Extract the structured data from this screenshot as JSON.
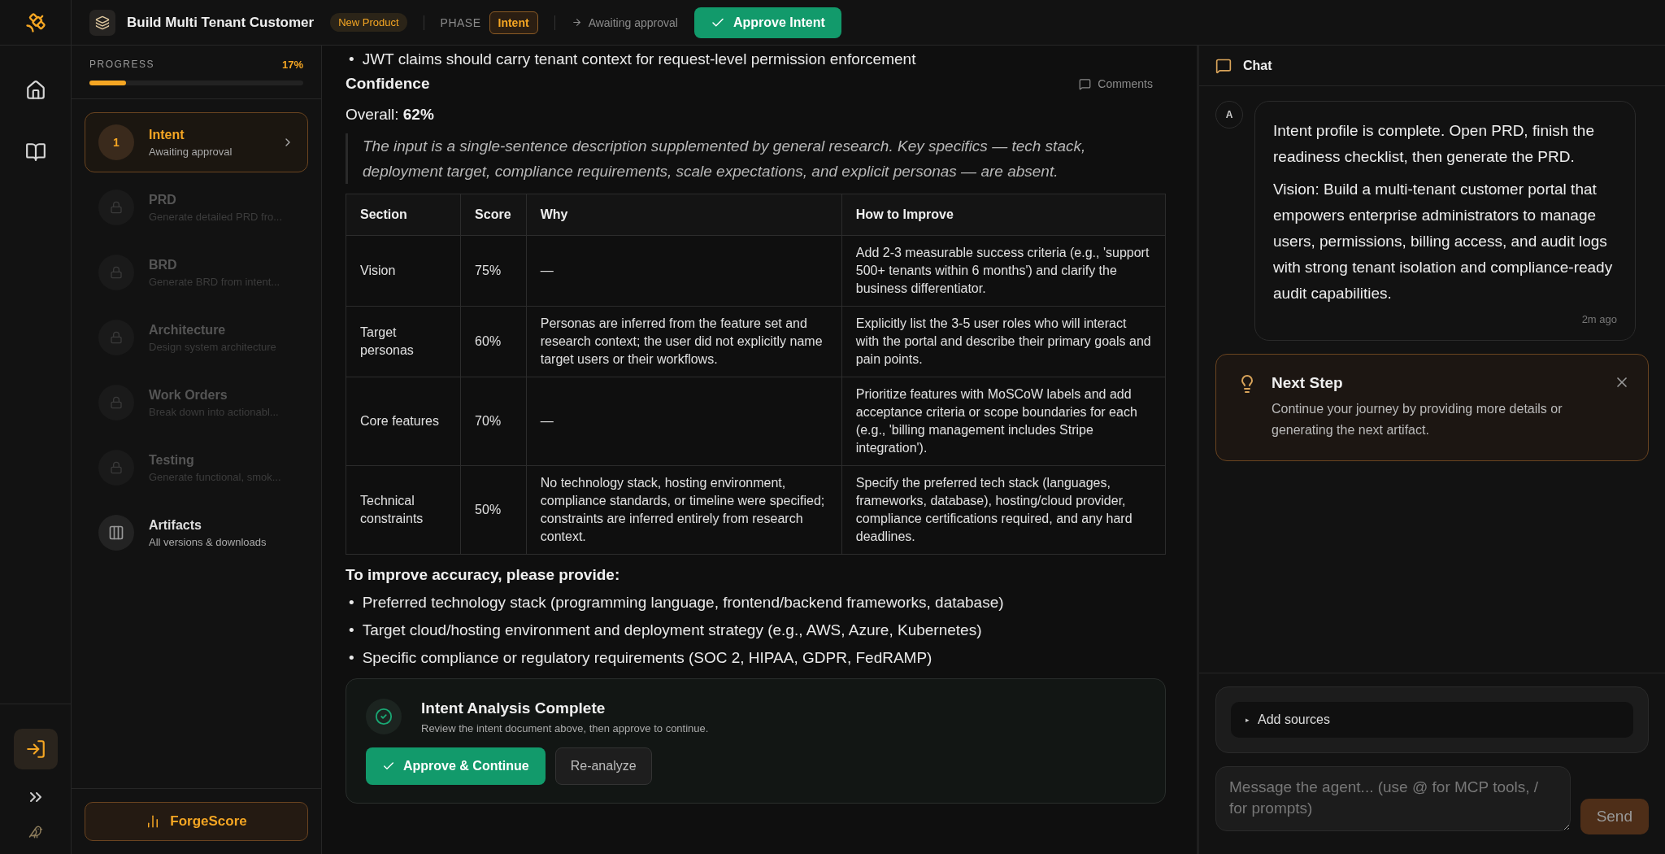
{
  "header": {
    "project_title": "Build Multi Tenant Customer",
    "badge": "New Product",
    "phase_label": "PHASE",
    "phase": "Intent",
    "status": "Awaiting approval",
    "approve_button": "Approve Intent"
  },
  "progress": {
    "label": "PROGRESS",
    "value": "17%",
    "level": 0.17
  },
  "steps": [
    {
      "kind": "numbered",
      "number": "1",
      "title": "Intent",
      "subtitle": "Awaiting approval",
      "selected": true
    },
    {
      "kind": "locked",
      "title": "PRD",
      "subtitle": "Generate detailed PRD fro...",
      "selected": false
    },
    {
      "kind": "locked",
      "title": "BRD",
      "subtitle": "Generate BRD from intent...",
      "selected": false
    },
    {
      "kind": "locked",
      "title": "Architecture",
      "subtitle": "Design system architecture",
      "selected": false
    },
    {
      "kind": "locked",
      "title": "Work Orders",
      "subtitle": "Break down into actionabl...",
      "selected": false
    },
    {
      "kind": "locked",
      "title": "Testing",
      "subtitle": "Generate functional, smok...",
      "selected": false
    },
    {
      "kind": "artifacts",
      "title": "Artifacts",
      "subtitle": "All versions & downloads",
      "selected": false
    }
  ],
  "forgescore_button": "ForgeScore",
  "document": {
    "bullet_marker": "•",
    "top_bullets": [
      "JWT claims should carry tenant context for request-level permission enforcement"
    ],
    "confidence_heading": "Confidence",
    "comments_button": "Comments",
    "overall": "Overall: **62%**",
    "quote": "The input is a single-sentence description supplemented by general research. Key specifics — tech stack, deployment target, compliance requirements, scale expectations, and explicit personas — are absent.",
    "table": {
      "columns": [
        "Section",
        "Score",
        "Why",
        "How to Improve"
      ],
      "rows": [
        [
          "Vision",
          "75%",
          "—",
          "Add 2-3 measurable success criteria (e.g., 'support 500+ tenants within 6 months') and clarify the business differentiator."
        ],
        [
          "Target personas",
          "60%",
          "Personas are inferred from the feature set and research context; the user did not explicitly name target users or their workflows.",
          "Explicitly list the 3-5 user roles who will interact with the portal and describe their primary goals and pain points."
        ],
        [
          "Core features",
          "70%",
          "—",
          "Prioritize features with MoSCoW labels and add acceptance criteria or scope boundaries for each (e.g., 'billing management includes Stripe integration')."
        ],
        [
          "Technical constraints",
          "50%",
          "No technology stack, hosting environment, compliance standards, or timeline were specified; constraints are inferred entirely from research context.",
          "Specify the preferred tech stack (languages, frameworks, database), hosting/cloud provider, compliance certifications required, and any hard deadlines."
        ]
      ]
    },
    "improve_heading": "To improve accuracy, please provide:",
    "improve_bullets": [
      "Preferred technology stack (programming language, frontend/backend frameworks, database)",
      "Target cloud/hosting environment and deployment strategy (e.g., AWS, Azure, Kubernetes)",
      "Specific compliance or regulatory requirements (SOC 2, HIPAA, GDPR, FedRAMP)"
    ]
  },
  "completion_card": {
    "title": "Intent Analysis Complete",
    "text": "Review the intent document above, then approve to continue.",
    "approve_button": "Approve & Continue",
    "reanalyze_button": "Re-analyze"
  },
  "chat": {
    "title": "Chat",
    "messages": [
      {
        "avatar": "A",
        "paragraphs": [
          "Intent profile is complete. Open PRD, finish the readiness checklist, then generate the PRD.",
          "Vision: Build a multi-tenant customer portal that empowers enterprise administrators to manage users, permissions, billing access, and audit logs with strong tenant isolation and compliance-ready audit capabilities."
        ],
        "time": "2m ago"
      }
    ],
    "next_step": {
      "title": "Next Step",
      "text": "Continue your journey by providing more details or generating the next artifact."
    },
    "add_sources_marker": "▸",
    "add_sources": "Add sources",
    "input_placeholder": "Message the agent... (use @ for MCP tools, / for prompts)",
    "send_button": "Send"
  }
}
